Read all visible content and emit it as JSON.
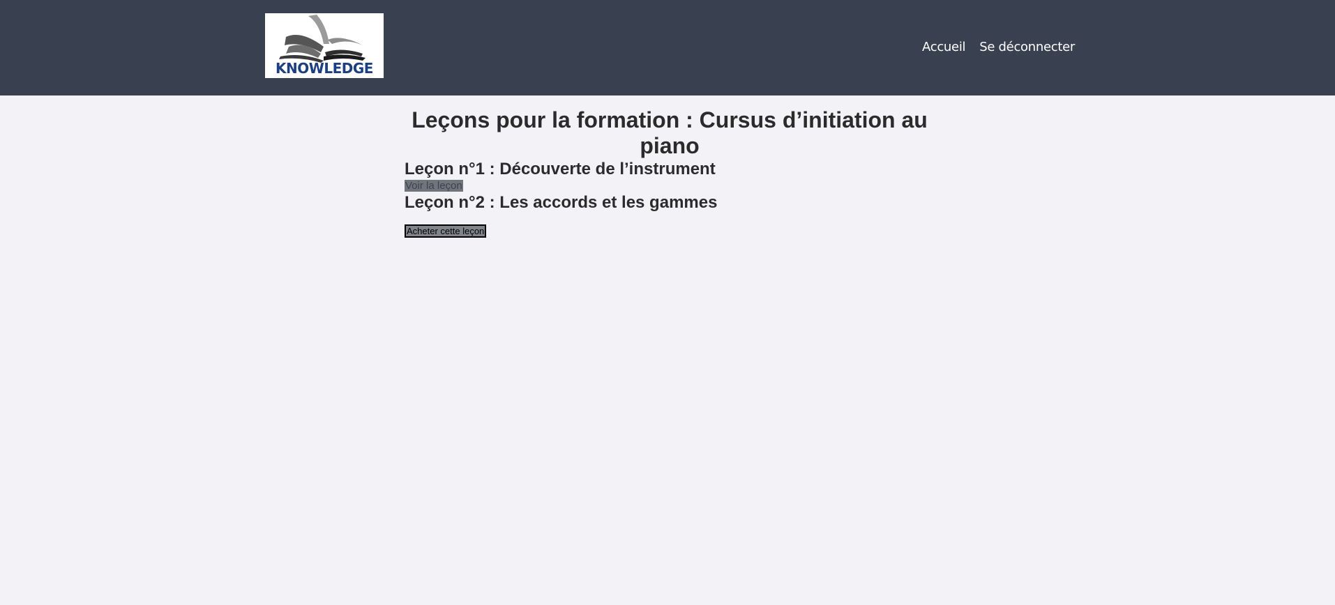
{
  "header": {
    "logo_text": "KNOWLEDGE",
    "nav": [
      {
        "label": "Accueil"
      },
      {
        "label": "Se déconnecter"
      }
    ]
  },
  "main": {
    "page_title": "Leçons pour la formation : Cursus d’initiation au piano",
    "lessons": [
      {
        "title": "Leçon n°1 : Découverte de l’instrument",
        "action_label": "Voir la leçon"
      },
      {
        "title": "Leçon n°2 : Les accords et les gammes",
        "action_label": "Acheter cette leçon"
      }
    ]
  },
  "colors": {
    "header_bg": "#394050",
    "page_bg": "#f3f3f7",
    "logo_text": "#1c3f82"
  }
}
